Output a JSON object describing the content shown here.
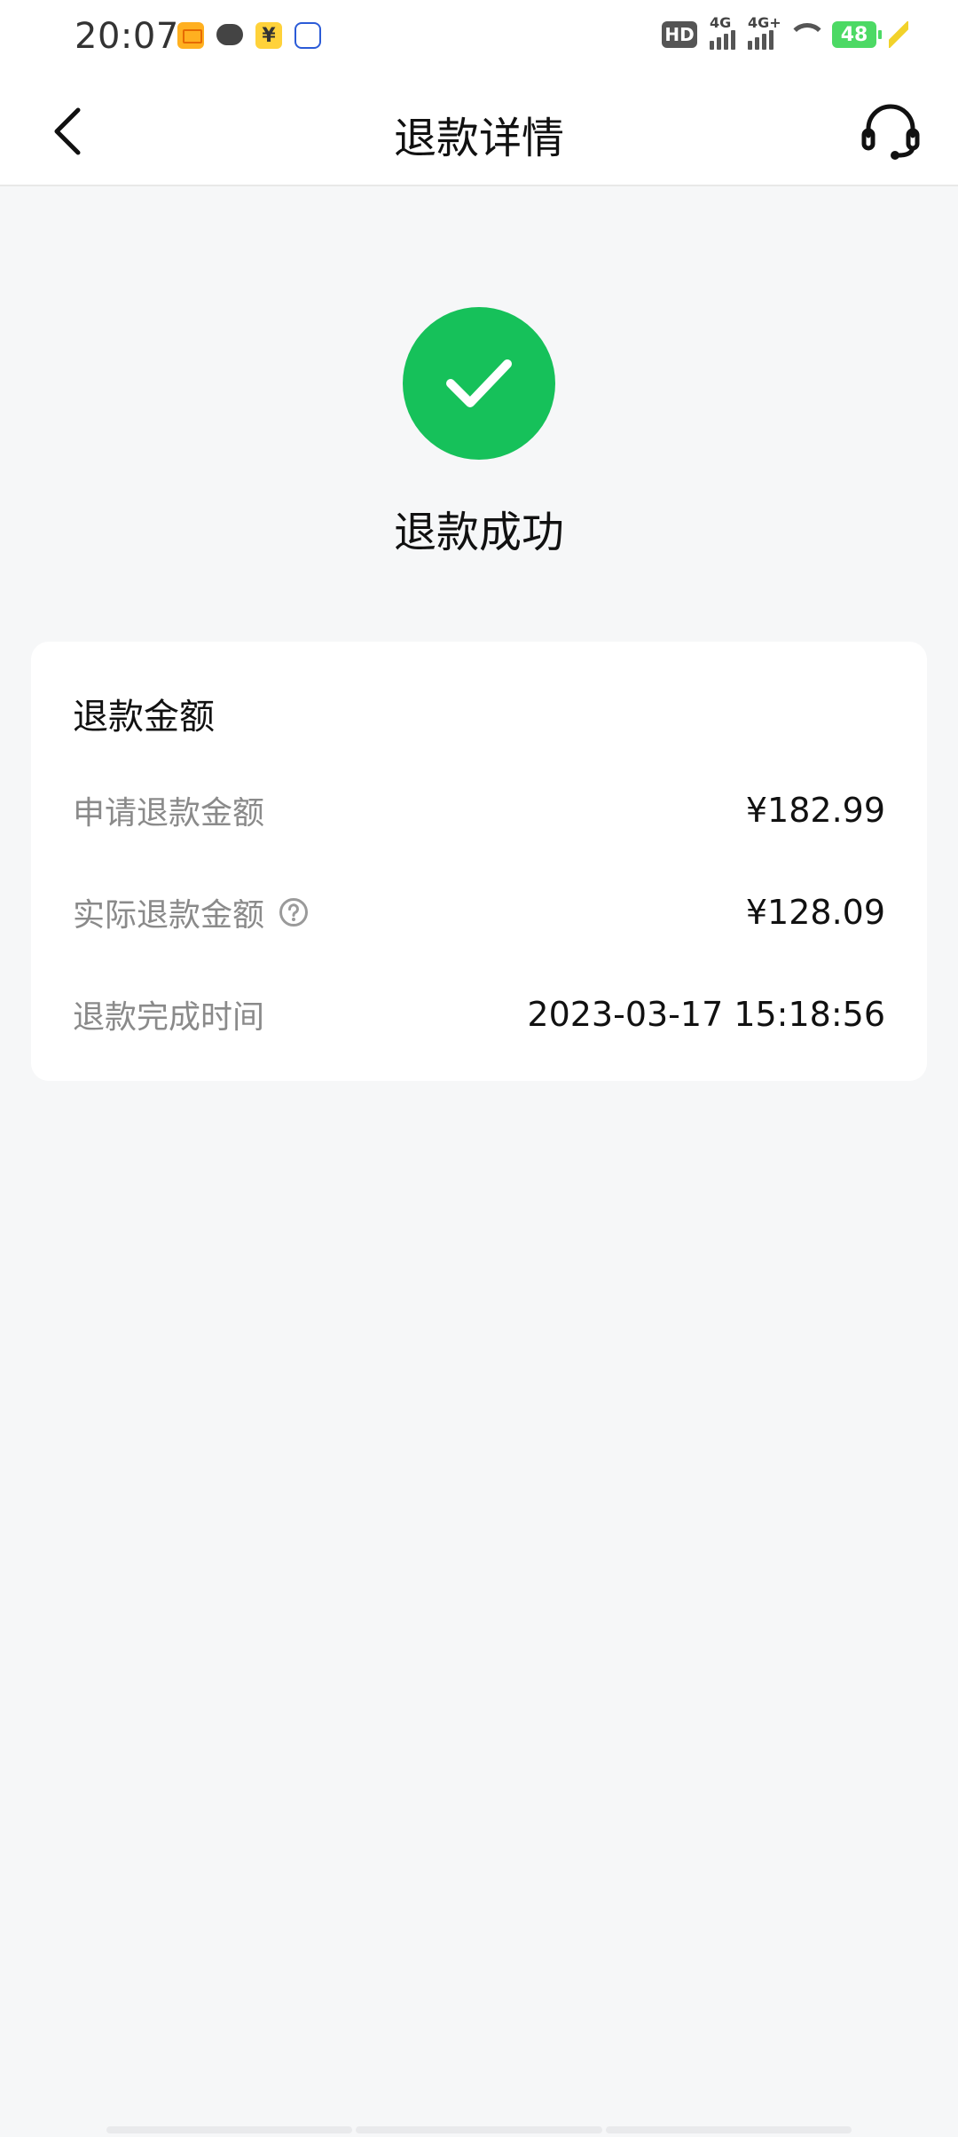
{
  "status_bar": {
    "time": "20:07",
    "hd": "HD",
    "net1": "4G",
    "net2": "4G+",
    "battery": "48"
  },
  "header": {
    "title": "退款详情"
  },
  "status": {
    "text": "退款成功",
    "color": "#16c15a"
  },
  "card": {
    "title": "退款金额",
    "rows": [
      {
        "label": "申请退款金额",
        "value": "¥182.99"
      },
      {
        "label": "实际退款金额",
        "value": "¥128.09"
      },
      {
        "label": "退款完成时间",
        "value": "2023-03-17 15:18:56"
      }
    ]
  },
  "icons": {
    "back": "chevron-left-icon",
    "support": "headset-icon",
    "success": "check-icon",
    "help": "question-circle-icon"
  }
}
